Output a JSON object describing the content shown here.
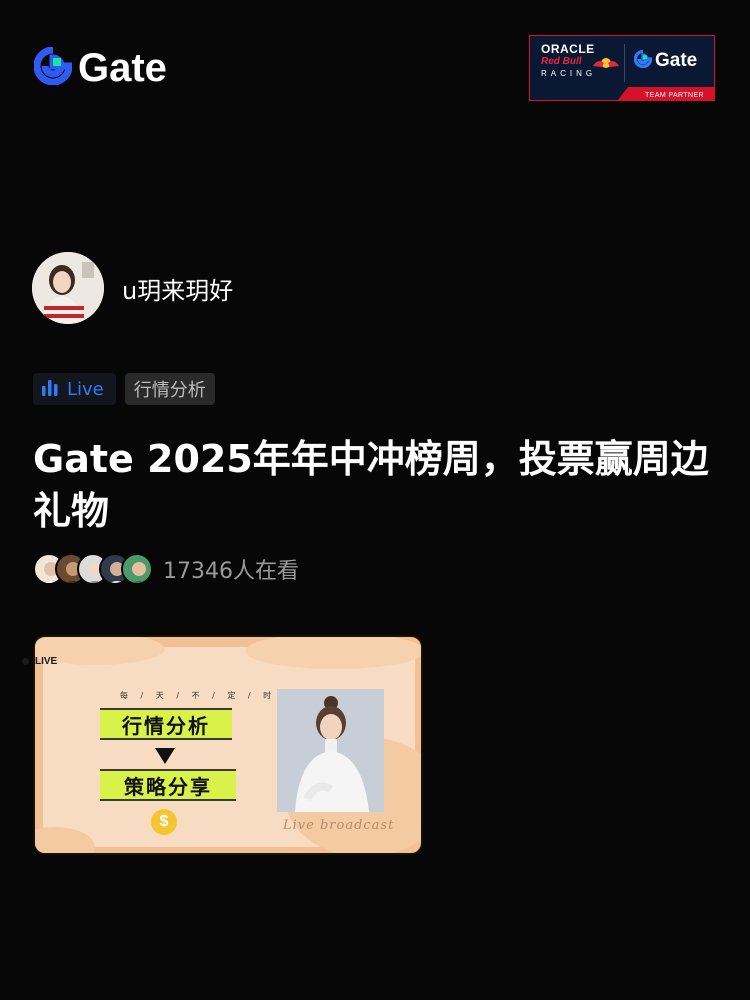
{
  "header": {
    "logo_text": "Gate",
    "logo_icon": "gate-logo-icon",
    "partner": {
      "line1": "ORACLE",
      "line2": "Red Bull",
      "line3": "RACING",
      "brand": "Gate",
      "strip": "TEAM PARTNER"
    }
  },
  "host": {
    "name": "u玥来玥好",
    "avatar_icon": "avatar"
  },
  "tags": {
    "live_label": "Live",
    "live_icon": "bar-chart-icon",
    "category": "行情分析"
  },
  "title": "Gate 2025年年中冲榜周，投票赢周边礼物",
  "viewers": {
    "count_text": "17346人在看",
    "avatar_count": 5
  },
  "cover": {
    "live_label": "LIVE",
    "subtitle": "每 / 天 / 不 / 定 / 时 / 直 / 播",
    "banner1": "行情分析",
    "banner2": "策略分享",
    "coin_symbol": "$",
    "script_text": "Live broadcast"
  },
  "colors": {
    "background": "#070707",
    "accent_blue": "#2f7bf5",
    "gate_green": "#17e6a1",
    "cover_orange": "#f2c095",
    "banner_lime": "#d9f24a"
  }
}
